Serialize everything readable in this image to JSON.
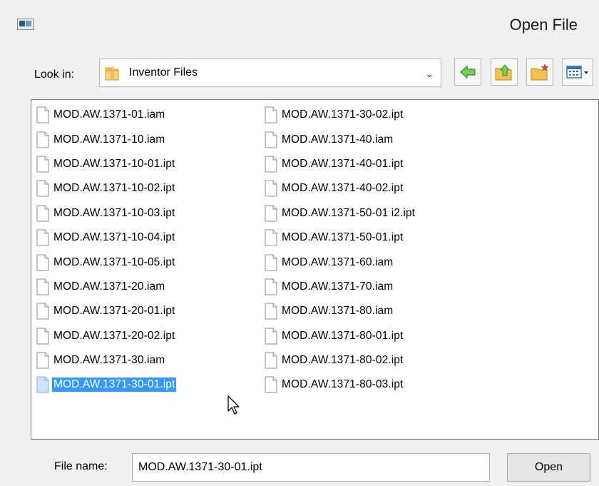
{
  "window": {
    "title": "Open File",
    "icon": "app-window-icon"
  },
  "look_in": {
    "label": "Look in:",
    "value": "Inventor Files",
    "icon": "folder-icon"
  },
  "toolbar": {
    "back_icon": "back-arrow-icon",
    "up_icon": "up-folder-icon",
    "new_folder_icon": "new-folder-icon",
    "view_menu_icon": "view-menu-icon"
  },
  "files": {
    "column1": [
      "MOD.AW.1371-01.iam",
      "MOD.AW.1371-10.iam",
      "MOD.AW.1371-10-01.ipt",
      "MOD.AW.1371-10-02.ipt",
      "MOD.AW.1371-10-03.ipt",
      "MOD.AW.1371-10-04.ipt",
      "MOD.AW.1371-10-05.ipt",
      "MOD.AW.1371-20.iam",
      "MOD.AW.1371-20-01.ipt",
      "MOD.AW.1371-20-02.ipt",
      "MOD.AW.1371-30.iam",
      "MOD.AW.1371-30-01.ipt"
    ],
    "column2": [
      "MOD.AW.1371-30-02.ipt",
      "MOD.AW.1371-40.iam",
      "MOD.AW.1371-40-01.ipt",
      "MOD.AW.1371-40-02.ipt",
      "MOD.AW.1371-50-01 i2.ipt",
      "MOD.AW.1371-50-01.ipt",
      "MOD.AW.1371-60.iam",
      "MOD.AW.1371-70.iam",
      "MOD.AW.1371-80.iam",
      "MOD.AW.1371-80-01.ipt",
      "MOD.AW.1371-80-02.ipt",
      "MOD.AW.1371-80-03.ipt"
    ],
    "selected": "MOD.AW.1371-30-01.ipt"
  },
  "file_name": {
    "label": "File name:",
    "value": "MOD.AW.1371-30-01.ipt"
  },
  "open_button": {
    "label": "Open"
  },
  "colors": {
    "selection": "#3399ff",
    "window_bg": "#f0f0f0"
  }
}
